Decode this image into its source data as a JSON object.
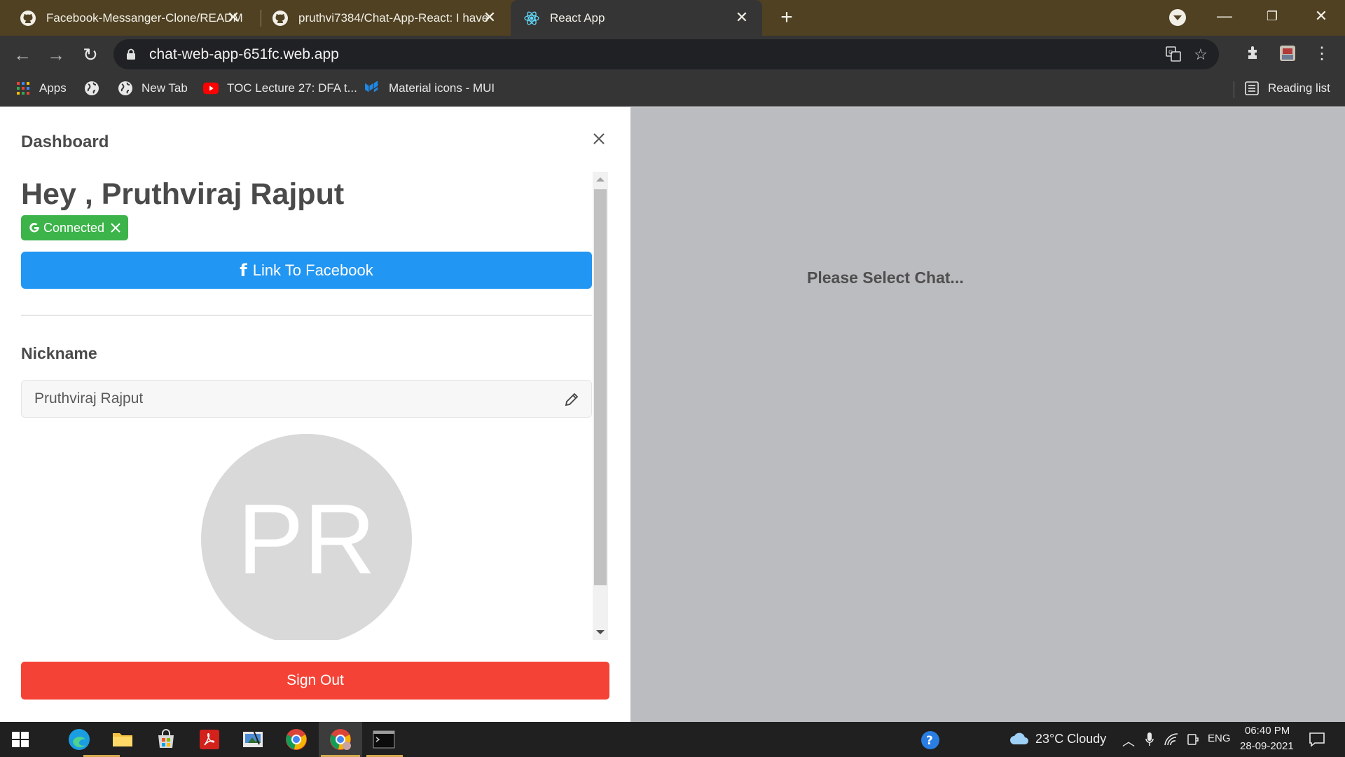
{
  "browser": {
    "tabs": [
      {
        "title": "Facebook-Messanger-Clone/READM",
        "icon": "github-icon",
        "active": false
      },
      {
        "title": "pruthvi7384/Chat-App-React: I have",
        "icon": "github-icon",
        "active": false
      },
      {
        "title": "React App",
        "icon": "react-icon",
        "active": true
      }
    ],
    "url": "chat-web-app-651fc.web.app",
    "bookmarks": [
      {
        "label": "Apps",
        "icon": "apps-grid-icon"
      },
      {
        "label": "",
        "icon": "globe-icon"
      },
      {
        "label": "New Tab",
        "icon": "globe-icon"
      },
      {
        "label": "TOC Lecture 27: DFA t...",
        "icon": "youtube-icon"
      },
      {
        "label": "Material icons - MUI",
        "icon": "mui-icon"
      }
    ],
    "reading_list": "Reading list"
  },
  "drawer": {
    "title": "Dashboard",
    "greeting": "Hey , Pruthviraj Rajput",
    "connected_badge": "Connected",
    "facebook_button": "Link To Facebook",
    "nickname_label": "Nickname",
    "nickname_value": "Pruthviraj Rajput",
    "avatar_initials": "PR",
    "sign_out": "Sign Out"
  },
  "main": {
    "placeholder": "Please Select Chat..."
  },
  "taskbar": {
    "weather": "23°C  Cloudy",
    "language": "ENG",
    "time": "06:40 PM",
    "date": "28-09-2021"
  },
  "colors": {
    "connected_green": "#3cb44a",
    "facebook_blue": "#2196f3",
    "signout_red": "#f44336",
    "overlay_gray": "#bbbcc0"
  }
}
